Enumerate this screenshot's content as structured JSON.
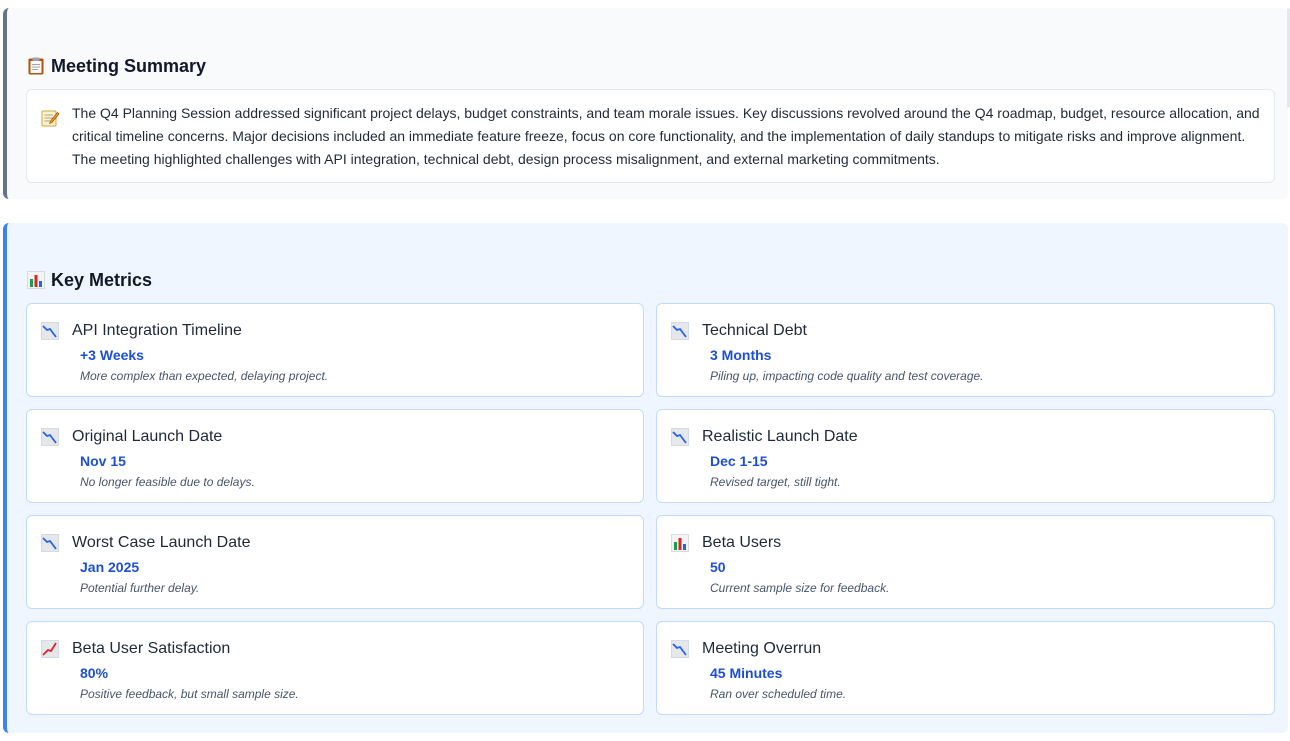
{
  "summary": {
    "heading": "Meeting Summary",
    "heading_icon": "clipboard-icon",
    "text_icon": "memo-icon",
    "text": "The Q4 Planning Session addressed significant project delays, budget constraints, and team morale issues. Key discussions revolved around the Q4 roadmap, budget, resource allocation, and critical timeline concerns. Major decisions included an immediate feature freeze, focus on core functionality, and the implementation of daily standups to mitigate risks and improve alignment. The meeting highlighted challenges with API integration, technical debt, design process misalignment, and external marketing commitments."
  },
  "metrics": {
    "heading": "Key Metrics",
    "heading_icon": "bar-chart-icon",
    "items": [
      {
        "title": "API Integration Timeline",
        "value": "+3 Weeks",
        "note": "More complex than expected, delaying project.",
        "icon": "chart-decreasing-icon"
      },
      {
        "title": "Technical Debt",
        "value": "3 Months",
        "note": "Piling up, impacting code quality and test coverage.",
        "icon": "chart-decreasing-icon"
      },
      {
        "title": "Original Launch Date",
        "value": "Nov 15",
        "note": "No longer feasible due to delays.",
        "icon": "chart-decreasing-icon"
      },
      {
        "title": "Realistic Launch Date",
        "value": "Dec 1-15",
        "note": "Revised target, still tight.",
        "icon": "chart-decreasing-icon"
      },
      {
        "title": "Worst Case Launch Date",
        "value": "Jan 2025",
        "note": "Potential further delay.",
        "icon": "chart-decreasing-icon"
      },
      {
        "title": "Beta Users",
        "value": "50",
        "note": "Current sample size for feedback.",
        "icon": "bar-chart-icon"
      },
      {
        "title": "Beta User Satisfaction",
        "value": "80%",
        "note": "Positive feedback, but small sample size.",
        "icon": "chart-increasing-icon"
      },
      {
        "title": "Meeting Overrun",
        "value": "45 Minutes",
        "note": "Ran over scheduled time.",
        "icon": "chart-decreasing-icon"
      }
    ]
  },
  "colors": {
    "summary_accent": "#64748b",
    "metrics_accent": "#3b82f6",
    "metric_value": "#1d4ed8"
  }
}
